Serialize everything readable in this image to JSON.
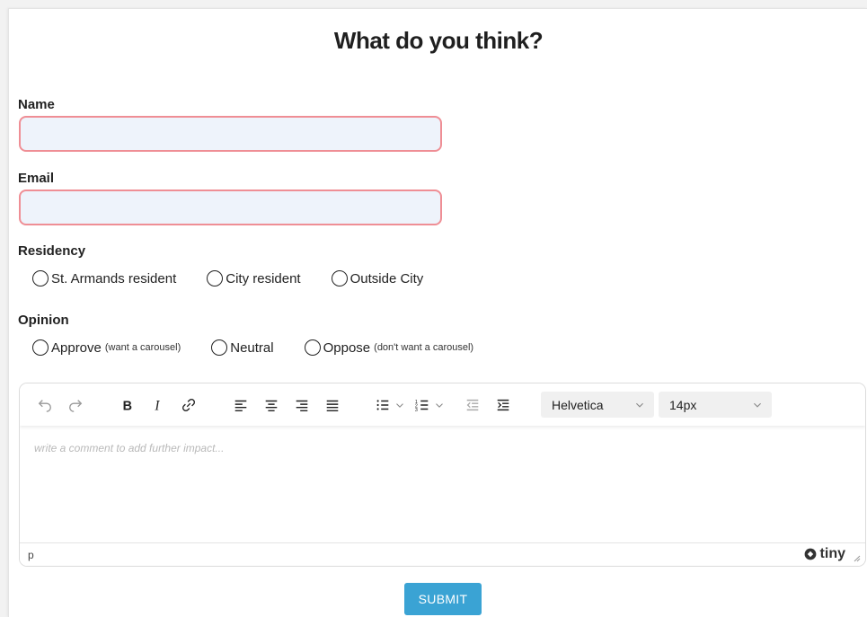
{
  "form": {
    "title": "What do you think?",
    "name_label": "Name",
    "name_value": "",
    "email_label": "Email",
    "email_value": "",
    "residency_label": "Residency",
    "residency_options": [
      "St. Armands resident",
      "City resident",
      "Outside City"
    ],
    "opinion_label": "Opinion",
    "opinion_options": [
      {
        "label": "Approve",
        "note": "(want a carousel)"
      },
      {
        "label": "Neutral",
        "note": ""
      },
      {
        "label": "Oppose",
        "note": "(don't want a carousel)"
      }
    ]
  },
  "editor": {
    "font_family": "Helvetica",
    "font_size": "14px",
    "placeholder": "write a comment to add further impact...",
    "status_path": "p",
    "brand": "tiny"
  },
  "submit_label": "SUBMIT",
  "colors": {
    "input_border": "#ef8e95",
    "input_bg": "#eef3fb",
    "submit_bg": "#3aa3d4"
  }
}
